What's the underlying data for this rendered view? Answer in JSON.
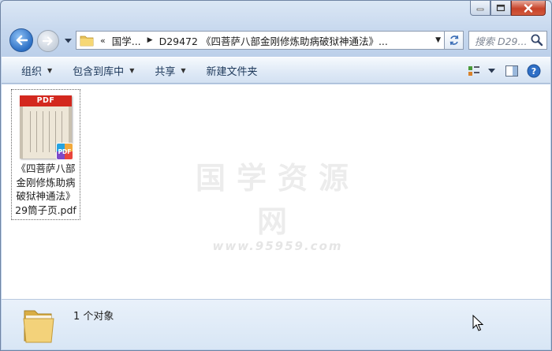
{
  "window": {
    "caption_buttons": [
      "minimize",
      "maximize",
      "close"
    ]
  },
  "nav": {
    "back_icon": "back-arrow-icon",
    "forward_icon": "forward-arrow-icon",
    "address": {
      "overflow": "«",
      "crumb_1": "国学...",
      "crumb_2": "D29472 《四菩萨八部金刚修炼助病破狱神通法》..."
    },
    "search_placeholder": "搜索 D29..."
  },
  "toolbar": {
    "organize": "组织",
    "include_in_library": "包含到库中",
    "share": "共享",
    "new_folder": "新建文件夹"
  },
  "content": {
    "files": [
      {
        "name": "《四菩萨八部金刚修炼助病破狱神通法》29筒子页.pdf",
        "thumb_header": "PDF",
        "badge": "PDF",
        "icon": "pdf-file-icon"
      }
    ],
    "watermark": {
      "title": "国学资源网",
      "url": "www.95959.com"
    }
  },
  "details": {
    "count_text": "1 个对象"
  },
  "colors": {
    "accent": "#2c6fc4",
    "close": "#c7432a",
    "toolbar_text": "#1e395b"
  }
}
